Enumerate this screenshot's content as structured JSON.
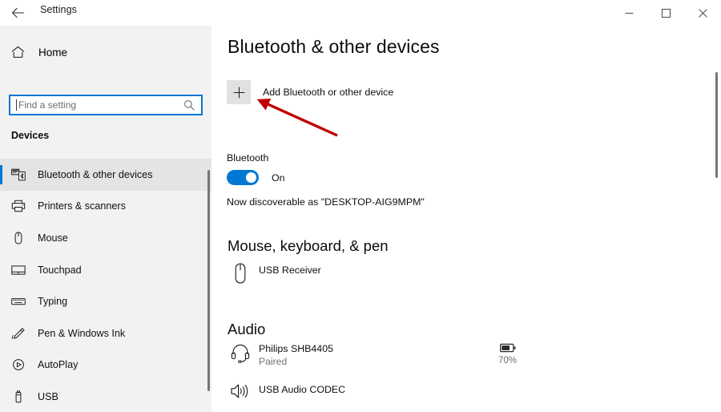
{
  "window": {
    "app_title": "Settings",
    "back_icon": "back-arrow-icon",
    "controls": {
      "minimize_label": "Minimize",
      "maximize_label": "Maximize",
      "close_label": "Close"
    }
  },
  "sidebar": {
    "home": {
      "label": "Home",
      "icon": "home-icon"
    },
    "search": {
      "placeholder": "Find a setting",
      "value": "",
      "icon": "search-icon"
    },
    "group_header": "Devices",
    "items": [
      {
        "label": "Bluetooth & other devices",
        "icon": "bluetooth-devices-icon",
        "selected": true
      },
      {
        "label": "Printers & scanners",
        "icon": "printer-icon",
        "selected": false
      },
      {
        "label": "Mouse",
        "icon": "mouse-icon",
        "selected": false
      },
      {
        "label": "Touchpad",
        "icon": "touchpad-icon",
        "selected": false
      },
      {
        "label": "Typing",
        "icon": "keyboard-icon",
        "selected": false
      },
      {
        "label": "Pen & Windows Ink",
        "icon": "pen-icon",
        "selected": false
      },
      {
        "label": "AutoPlay",
        "icon": "autoplay-icon",
        "selected": false
      },
      {
        "label": "USB",
        "icon": "usb-icon",
        "selected": false
      }
    ]
  },
  "main": {
    "page_title": "Bluetooth & other devices",
    "add_device": {
      "label": "Add Bluetooth or other device",
      "icon": "plus-icon"
    },
    "bluetooth": {
      "label": "Bluetooth",
      "toggle_state": "On",
      "discoverable_text": "Now discoverable as \"DESKTOP-AIG9MPM\""
    },
    "sections": [
      {
        "title": "Mouse, keyboard, & pen",
        "devices": [
          {
            "name": "USB Receiver",
            "status": "",
            "icon": "mouse-device-icon"
          }
        ]
      },
      {
        "title": "Audio",
        "devices": [
          {
            "name": "Philips SHB4405",
            "status": "Paired",
            "icon": "headset-icon",
            "battery": "70%"
          },
          {
            "name": "USB Audio CODEC",
            "status": "",
            "icon": "speaker-icon"
          }
        ]
      }
    ]
  },
  "annotation": {
    "type": "arrow",
    "color": "#c00000",
    "points_to": "add-bluetooth-plus-button"
  },
  "colors": {
    "accent": "#0078d4",
    "sidebar_bg": "#f2f2f2",
    "main_bg": "#ffffff",
    "button_bg": "#e1e1e1",
    "muted_text": "#717171",
    "annotation_red": "#c00000"
  }
}
